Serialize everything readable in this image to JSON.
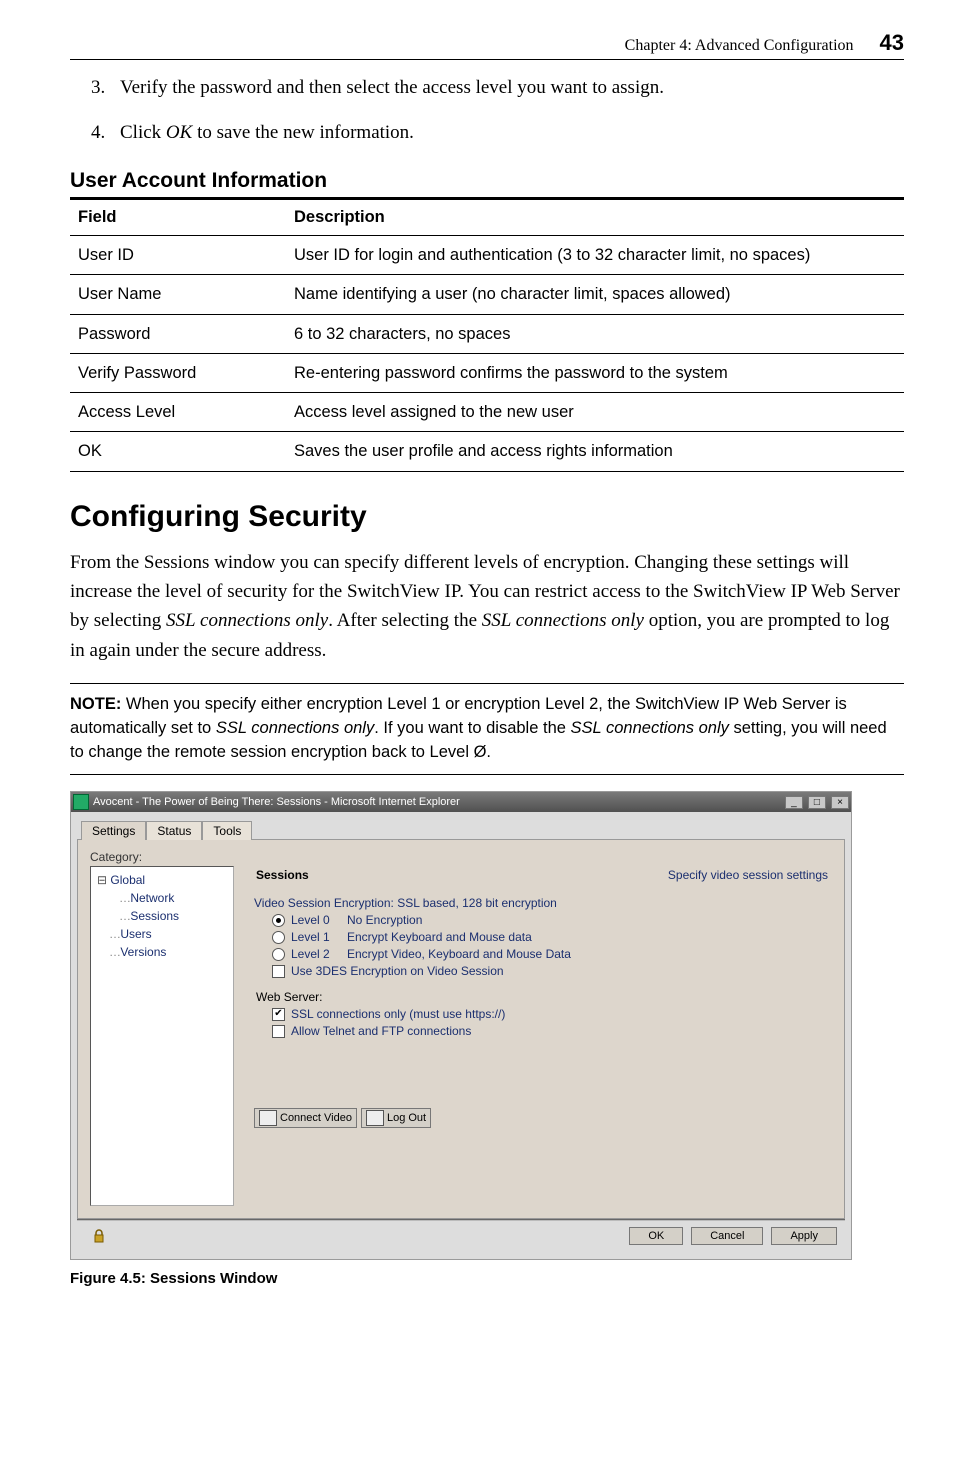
{
  "header": {
    "chapter": "Chapter 4: Advanced Configuration",
    "page_number": "43"
  },
  "steps": {
    "s3": "Verify the password and then select the access level you want to assign.",
    "s4_pre": "Click ",
    "s4_em": "OK",
    "s4_post": " to save the new information."
  },
  "user_account": {
    "heading": "User Account Information",
    "col_field": "Field",
    "col_desc": "Description",
    "rows": [
      {
        "field": "User ID",
        "desc": "User ID for login and authentication (3 to 32 character limit, no spaces)"
      },
      {
        "field": "User Name",
        "desc": "Name identifying a user (no character limit, spaces allowed)"
      },
      {
        "field": "Password",
        "desc": "6 to 32 characters, no spaces"
      },
      {
        "field": "Verify Password",
        "desc": "Re-entering password confirms the password to the system"
      },
      {
        "field": "Access Level",
        "desc": "Access level assigned to the new user"
      },
      {
        "field": "OK",
        "desc": "Saves the user profile and access rights information"
      }
    ]
  },
  "sec_heading": "Configuring Security",
  "sec_para": {
    "t1": "From the Sessions window you can specify different levels of encryption. Changing these settings will increase the level of security for the SwitchView IP. You can restrict access to the SwitchView IP Web Server by selecting ",
    "em1": "SSL connections only",
    "t2": ". After selecting the ",
    "em2": "SSL connections only",
    "t3": " option, you are prompted to log in again under the secure address."
  },
  "note": {
    "label": "NOTE:",
    "t1": " When you specify either encryption Level 1 or encryption Level 2, the SwitchView IP Web Server is automatically set to ",
    "em1": "SSL connections only",
    "t2": ". If you want to disable the ",
    "em2": "SSL connections only",
    "t3": " setting, you will need to change the remote session encryption back to Level Ø."
  },
  "shot": {
    "title": "Avocent - The Power of Being There: Sessions - Microsoft Internet Explorer",
    "tabs": {
      "settings": "Settings",
      "status": "Status",
      "tools": "Tools"
    },
    "category_label": "Category:",
    "tree": {
      "global": "Global",
      "network": "Network",
      "sessions": "Sessions",
      "users": "Users",
      "versions": "Versions"
    },
    "right": {
      "heading": "Sessions",
      "subheading": "Specify video session settings",
      "enc_header": "Video Session Encryption: SSL based, 128 bit encryption",
      "l0": "Level 0",
      "l0d": "No Encryption",
      "l1": "Level 1",
      "l1d": "Encrypt Keyboard and Mouse data",
      "l2": "Level 2",
      "l2d": "Encrypt Video, Keyboard and Mouse Data",
      "use3des": "Use 3DES Encryption on Video Session",
      "ws_header": "Web Server:",
      "ssl_only": "SSL connections only (must use https://)",
      "allow_telnet": "Allow Telnet and FTP connections",
      "connect": "Connect Video",
      "logout": "Log Out"
    },
    "buttons": {
      "ok": "OK",
      "cancel": "Cancel",
      "apply": "Apply"
    }
  },
  "figure_caption": "Figure 4.5: Sessions Window"
}
